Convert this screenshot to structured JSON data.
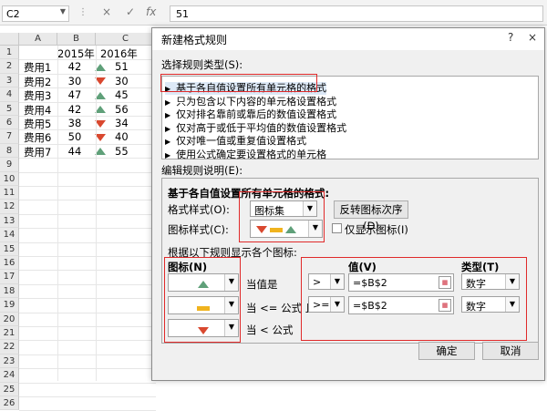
{
  "formula_bar": {
    "name_box": "C2",
    "content": "51",
    "cancel": "×",
    "enter": "✓",
    "fx": "fx"
  },
  "sheet": {
    "columns": [
      "A",
      "B",
      "C"
    ],
    "rows": [
      {
        "num": "1",
        "a": "",
        "b": "2015年",
        "c": "2016年",
        "arrow": ""
      },
      {
        "num": "2",
        "a": "费用1",
        "b": "42",
        "c": "51",
        "arrow": "up"
      },
      {
        "num": "3",
        "a": "费用2",
        "b": "30",
        "c": "30",
        "arrow": "down"
      },
      {
        "num": "4",
        "a": "费用3",
        "b": "47",
        "c": "45",
        "arrow": "up"
      },
      {
        "num": "5",
        "a": "费用4",
        "b": "42",
        "c": "56",
        "arrow": "up"
      },
      {
        "num": "6",
        "a": "费用5",
        "b": "38",
        "c": "34",
        "arrow": "down"
      },
      {
        "num": "7",
        "a": "费用6",
        "b": "50",
        "c": "40",
        "arrow": "down"
      },
      {
        "num": "8",
        "a": "费用7",
        "b": "44",
        "c": "55",
        "arrow": "up"
      },
      {
        "num": "9"
      },
      {
        "num": "10"
      },
      {
        "num": "11"
      },
      {
        "num": "12"
      },
      {
        "num": "13"
      },
      {
        "num": "14"
      },
      {
        "num": "15"
      },
      {
        "num": "16"
      },
      {
        "num": "17"
      },
      {
        "num": "18"
      },
      {
        "num": "19"
      },
      {
        "num": "20"
      },
      {
        "num": "21"
      },
      {
        "num": "22"
      },
      {
        "num": "23"
      },
      {
        "num": "24"
      },
      {
        "num": "25"
      },
      {
        "num": "26"
      }
    ]
  },
  "dialog": {
    "title": "新建格式规则",
    "help": "?",
    "close": "×",
    "rule_type_label": "选择规则类型(S):",
    "rule_types": [
      "基于各自值设置所有单元格的格式",
      "只为包含以下内容的单元格设置格式",
      "仅对排名靠前或靠后的数值设置格式",
      "仅对高于或低于平均值的数值设置格式",
      "仅对唯一值或重复值设置格式",
      "使用公式确定要设置格式的单元格"
    ],
    "edit_label": "编辑规则说明(E):",
    "section_title": "基于各自值设置所有单元格的格式:",
    "format_style_label": "格式样式(O):",
    "format_style_value": "图标集",
    "reverse_button": "反转图标次序(D)",
    "icon_style_label": "图标样式(C):",
    "show_icon_only": "仅显示图标(I)",
    "rules_hint": "根据以下规则显示各个图标:",
    "col_icon": "图标(N)",
    "col_value": "值(V)",
    "col_type": "类型(T)",
    "icon_rows": [
      {
        "desc": "当值是",
        "op": ">",
        "value": "=$B$2",
        "type": "数字"
      },
      {
        "desc": "当 <= 公式 且",
        "op": ">=",
        "value": "=$B$2",
        "type": "数字"
      },
      {
        "desc": "当 < 公式"
      }
    ],
    "ok": "确定",
    "cancel": "取消"
  },
  "colors": {
    "up_arrow": "#5fa079",
    "down_arrow": "#d9482f",
    "mid_bar": "#f0b31e",
    "highlight": "#e02a2a"
  }
}
